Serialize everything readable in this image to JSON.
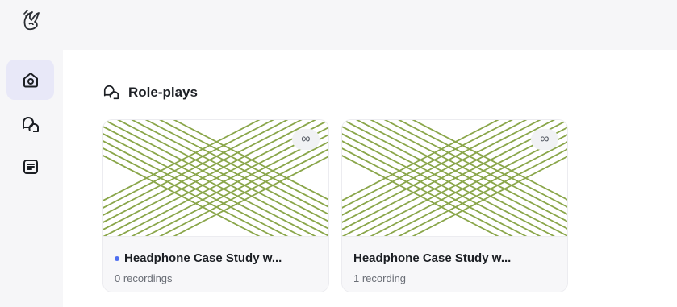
{
  "sidebar": {
    "items": [
      {
        "name": "home",
        "icon": "home-icon",
        "active": true
      },
      {
        "name": "roleplays",
        "icon": "chat-bubbles-icon",
        "active": false
      },
      {
        "name": "notes",
        "icon": "document-icon",
        "active": false
      }
    ]
  },
  "main": {
    "section_title": "Role-plays",
    "cards": [
      {
        "title": "Headphone Case Study w...",
        "subtitle": "0 recordings",
        "badge": "∞",
        "unread_dot": true
      },
      {
        "title": "Headphone Case Study w...",
        "subtitle": "1 recording",
        "badge": "∞",
        "unread_dot": false
      }
    ]
  },
  "colors": {
    "accent": "#4f6ff0",
    "pattern": "#8aa64a",
    "sidebar_active": "#e8e8f8"
  }
}
